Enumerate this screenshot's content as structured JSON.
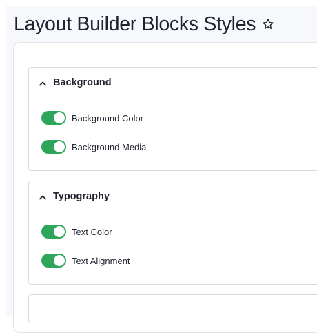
{
  "page": {
    "title": "Layout Builder Blocks Styles",
    "star_icon": "star-outline-icon"
  },
  "colors": {
    "toggle_on": "#2fa55b",
    "text": "#222330",
    "page_bg": "#f7f8fc",
    "border": "#d8d9e0"
  },
  "sections": [
    {
      "title": "Background",
      "expanded": true,
      "toggles": [
        {
          "label": "Background Color",
          "enabled": true
        },
        {
          "label": "Background Media",
          "enabled": true
        }
      ]
    },
    {
      "title": "Typography",
      "expanded": true,
      "toggles": [
        {
          "label": "Text Color",
          "enabled": true
        },
        {
          "label": "Text Alignment",
          "enabled": true
        }
      ]
    }
  ]
}
